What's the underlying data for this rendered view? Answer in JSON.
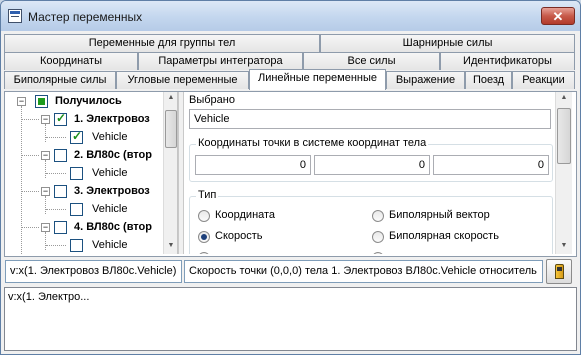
{
  "window": {
    "title": "Мастер переменных",
    "close_symbol": "✕"
  },
  "tabs": {
    "row1": [
      "Переменные для группы тел",
      "Шарнирные силы"
    ],
    "row2": [
      "Координаты",
      "Параметры интегратора",
      "Все силы",
      "Идентификаторы"
    ],
    "row3": [
      "Биполярные силы",
      "Угловые переменные",
      "Линейные переменные",
      "Выражение",
      "Поезд",
      "Реакции"
    ],
    "active": "Линейные переменные"
  },
  "tree": {
    "root": {
      "label": "Получилось",
      "checked": true
    },
    "items": [
      {
        "label": "1. Электровоз",
        "checked": true,
        "child": "Vehicle",
        "child_checked": true
      },
      {
        "label": "2. ВЛ80с (втор",
        "checked": false,
        "child": "Vehicle",
        "child_checked": false
      },
      {
        "label": "3. Электровоз",
        "checked": false,
        "child": "Vehicle",
        "child_checked": false
      },
      {
        "label": "4. ВЛ80с (втор",
        "checked": false,
        "child": "Vehicle",
        "child_checked": false
      }
    ],
    "expand_symbol": "−"
  },
  "details": {
    "selected_label": "Выбрано",
    "selected_value": "Vehicle",
    "coords_legend": "Координаты точки в системе координат тела",
    "coords": [
      "0",
      "0",
      "0"
    ],
    "type_legend": "Тип",
    "type_options": [
      {
        "label": "Координата",
        "selected": false
      },
      {
        "label": "Биполярный вектор",
        "selected": false
      },
      {
        "label": "Скорость",
        "selected": true
      },
      {
        "label": "Биполярная скорость",
        "selected": false
      }
    ]
  },
  "bottom": {
    "var_name": "v:x(1. Электровоз ВЛ80с.Vehicle)",
    "description": "Скорость точки (0,0,0) тела 1. Электровоз ВЛ80с.Vehicle относитель",
    "tool_icon": "pen-icon"
  },
  "output": {
    "text": "v:x(1. Электро..."
  }
}
